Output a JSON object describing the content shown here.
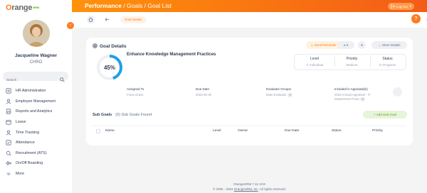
{
  "brand": {
    "logo_text": "OrangeHRM"
  },
  "sidebar": {
    "user_name": "Jacqueline Wagner",
    "user_role": "CHRO",
    "search_placeholder": "Search",
    "items": [
      {
        "label": "HR Administration",
        "icon": "admin-icon"
      },
      {
        "label": "Employee Management",
        "icon": "employee-icon"
      },
      {
        "label": "Reports and Analytics",
        "icon": "reports-icon"
      },
      {
        "label": "Leave",
        "icon": "leave-icon"
      },
      {
        "label": "Time Tracking",
        "icon": "time-icon"
      },
      {
        "label": "Attendance",
        "icon": "attendance-icon"
      },
      {
        "label": "Recruitment (ATS)",
        "icon": "recruitment-icon"
      },
      {
        "label": "On/Off Boarding",
        "icon": "onboarding-icon"
      },
      {
        "label": "More",
        "icon": "more-chevron-icon"
      }
    ]
  },
  "topbar": {
    "title_main": "Performance",
    "title_sub": " / Goals / Goal List",
    "logout_label": "Log Out"
  },
  "subbar": {
    "chip_label": "Goal Details"
  },
  "goal": {
    "section_title": "Goal Details",
    "name": "Enhance Knowledge Management Practices",
    "progress_text": "45%",
    "progress_value": 0.45,
    "send_reminder": "Send Reminder",
    "more_details": "More Details",
    "level_head": "Level",
    "level_value": "Individual",
    "priority_head": "Priority",
    "priority_value": "Medium",
    "status_head": "Status",
    "status_value": "In Progress",
    "assigned_to_head": "Assigned To",
    "assigned_to_value": "Fiona Grace",
    "due_date_head": "Due Date",
    "due_date_value": "2023-06-30",
    "evaluator_head": "Evaluator Groups",
    "evaluator_value": "Main Evaluator",
    "evaluator_badge": "+2",
    "appraisal_head": "Included in Appraisal(s)",
    "appraisal_value_1": "2023 Annual Appraisal - IT",
    "appraisal_value_2": "Department-Fiona",
    "appraisal_badge": "+2"
  },
  "subgoals": {
    "title": "Sub Goals",
    "count_text": "(0) Sub Goals Found",
    "add_label": "+ Add Sub Goal",
    "columns": [
      "Name",
      "Level",
      "Owner",
      "Due Date",
      "Status",
      "Priority"
    ]
  },
  "footer": {
    "version": "OrangeHRM 7.11-VAS",
    "copyright_prefix": "© 2005 - 2024 ",
    "company_link": "OrangeHRM, Inc",
    "copyright_suffix": ". All rights reserved."
  },
  "colors": {
    "accent": "#ff7b1d",
    "progress": "#1e9fea",
    "success": "#5aa511"
  }
}
